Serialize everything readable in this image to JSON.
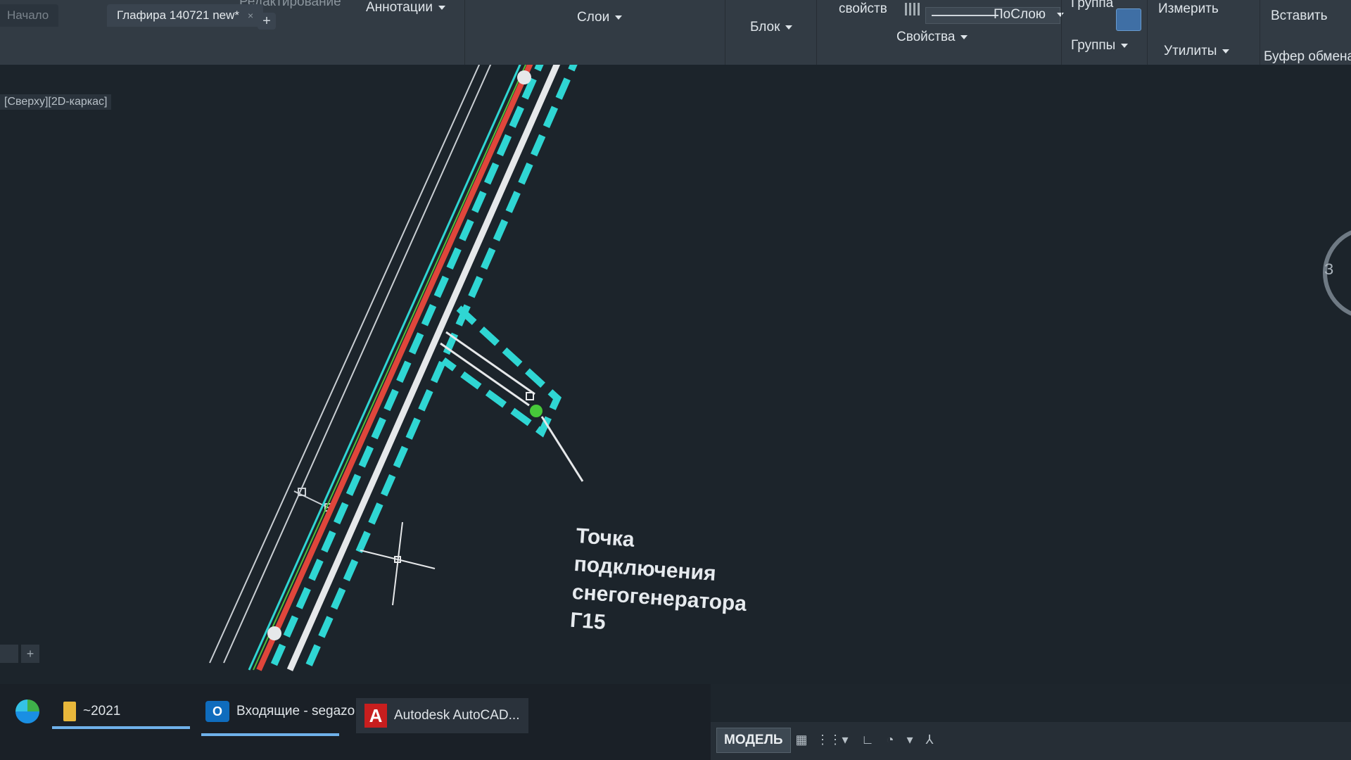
{
  "ribbon": {
    "tab_editing": "Редактирование",
    "annotations": "Аннотации",
    "layers": "Слои",
    "block": "Блок",
    "properties_top": "свойств",
    "bylayer": "ПоСлою",
    "properties": "Свойства",
    "group": "Группа",
    "groups": "Группы",
    "measure": "Измерить",
    "utilities": "Утилиты",
    "paste": "Вставить",
    "clipboard": "Буфер обмена"
  },
  "tabs": {
    "start": "Начало",
    "doc": "Глафира 140721 new*",
    "close": "×",
    "add": "+"
  },
  "viewport": {
    "label": "[Сверху][2D-каркас]"
  },
  "callout": {
    "line1": "Точка",
    "line2": "подключения",
    "line3": "снегогенератора",
    "line4": "Г15"
  },
  "navcube": {
    "label": "З"
  },
  "layout_tabs": {
    "add": "+"
  },
  "statusbar": {
    "model": "МОДЕЛЬ"
  },
  "taskbar": {
    "folder": "~2021",
    "outlook": "Входящие - segazo...",
    "autocad": "Autodesk AutoCAD..."
  },
  "colors": {
    "cyan_dash": "#2fd6d3",
    "red_line": "#e0463b",
    "white_line": "#e6e8ea",
    "green_node": "#47c93a",
    "background": "#1c242b"
  }
}
